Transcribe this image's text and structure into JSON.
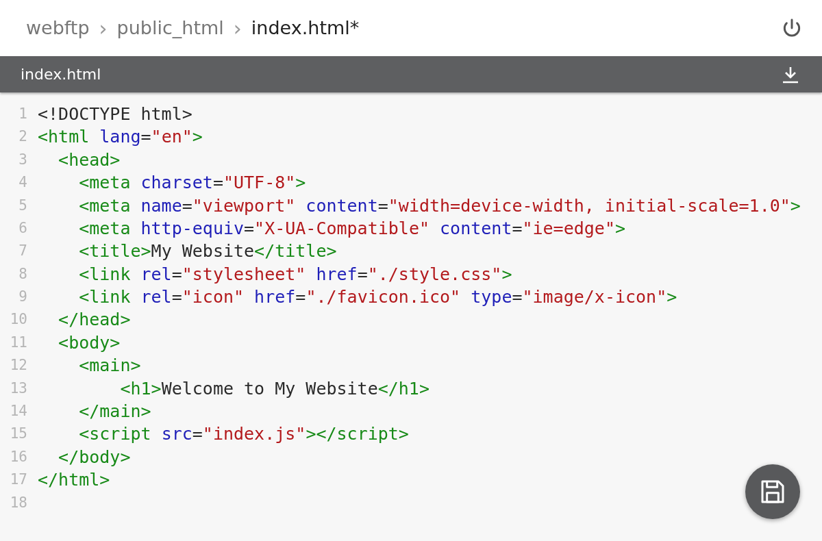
{
  "breadcrumb": [
    {
      "label": "webftp",
      "current": false
    },
    {
      "label": "›",
      "kind": "separator"
    },
    {
      "label": "public_html",
      "current": false
    },
    {
      "label": "›",
      "kind": "separator"
    },
    {
      "label": "index.html*",
      "current": true
    }
  ],
  "file_bar": {
    "title": "index.html"
  },
  "editor": {
    "lines": [
      {
        "number": "1",
        "tokens": [
          {
            "kind": "plain",
            "text": "<!DOCTYPE html>"
          }
        ]
      },
      {
        "number": "2",
        "tokens": [
          {
            "kind": "tag",
            "text": "<html"
          },
          {
            "kind": "attr",
            "text": " lang"
          },
          {
            "kind": "plain",
            "text": "="
          },
          {
            "kind": "str",
            "text": "\"en\""
          },
          {
            "kind": "tag",
            "text": ">"
          }
        ]
      },
      {
        "number": "3",
        "tokens": [
          {
            "kind": "tag",
            "text": "  <head>"
          }
        ]
      },
      {
        "number": "4",
        "tokens": [
          {
            "kind": "tag",
            "text": "    <meta"
          },
          {
            "kind": "attr",
            "text": " charset"
          },
          {
            "kind": "plain",
            "text": "="
          },
          {
            "kind": "str",
            "text": "\"UTF-8\""
          },
          {
            "kind": "tag",
            "text": ">"
          }
        ]
      },
      {
        "number": "5",
        "tokens": [
          {
            "kind": "tag",
            "text": "    <meta"
          },
          {
            "kind": "attr",
            "text": " name"
          },
          {
            "kind": "plain",
            "text": "="
          },
          {
            "kind": "str",
            "text": "\"viewport\""
          },
          {
            "kind": "attr",
            "text": " content"
          },
          {
            "kind": "plain",
            "text": "="
          },
          {
            "kind": "str",
            "text": "\"width=device-width, initial-scale=1.0\""
          },
          {
            "kind": "tag",
            "text": ">"
          }
        ]
      },
      {
        "number": "6",
        "tokens": [
          {
            "kind": "tag",
            "text": "    <meta"
          },
          {
            "kind": "attr",
            "text": " http-equiv"
          },
          {
            "kind": "plain",
            "text": "="
          },
          {
            "kind": "str",
            "text": "\"X-UA-Compatible\""
          },
          {
            "kind": "attr",
            "text": " content"
          },
          {
            "kind": "plain",
            "text": "="
          },
          {
            "kind": "str",
            "text": "\"ie=edge\""
          },
          {
            "kind": "tag",
            "text": ">"
          }
        ]
      },
      {
        "number": "7",
        "tokens": [
          {
            "kind": "tag",
            "text": "    <title>"
          },
          {
            "kind": "plain",
            "text": "My Website"
          },
          {
            "kind": "tag",
            "text": "</title>"
          }
        ]
      },
      {
        "number": "8",
        "tokens": [
          {
            "kind": "tag",
            "text": "    <link"
          },
          {
            "kind": "attr",
            "text": " rel"
          },
          {
            "kind": "plain",
            "text": "="
          },
          {
            "kind": "str",
            "text": "\"stylesheet\""
          },
          {
            "kind": "attr",
            "text": " href"
          },
          {
            "kind": "plain",
            "text": "="
          },
          {
            "kind": "str",
            "text": "\"./style.css\""
          },
          {
            "kind": "tag",
            "text": ">"
          }
        ]
      },
      {
        "number": "9",
        "tokens": [
          {
            "kind": "tag",
            "text": "    <link"
          },
          {
            "kind": "attr",
            "text": " rel"
          },
          {
            "kind": "plain",
            "text": "="
          },
          {
            "kind": "str",
            "text": "\"icon\""
          },
          {
            "kind": "attr",
            "text": " href"
          },
          {
            "kind": "plain",
            "text": "="
          },
          {
            "kind": "str",
            "text": "\"./favicon.ico\""
          },
          {
            "kind": "attr",
            "text": " type"
          },
          {
            "kind": "plain",
            "text": "="
          },
          {
            "kind": "str",
            "text": "\"image/x-icon\""
          },
          {
            "kind": "tag",
            "text": ">"
          }
        ]
      },
      {
        "number": "10",
        "tokens": [
          {
            "kind": "tag",
            "text": "  </head>"
          }
        ]
      },
      {
        "number": "11",
        "tokens": [
          {
            "kind": "tag",
            "text": "  <body>"
          }
        ]
      },
      {
        "number": "12",
        "tokens": [
          {
            "kind": "tag",
            "text": "    <main>"
          }
        ]
      },
      {
        "number": "13",
        "tokens": [
          {
            "kind": "tag",
            "text": "        <h1>"
          },
          {
            "kind": "plain",
            "text": "Welcome to My Website"
          },
          {
            "kind": "tag",
            "text": "</h1>"
          }
        ]
      },
      {
        "number": "14",
        "tokens": [
          {
            "kind": "tag",
            "text": "    </main>"
          }
        ]
      },
      {
        "number": "15",
        "tokens": [
          {
            "kind": "tag",
            "text": "    <script"
          },
          {
            "kind": "attr",
            "text": " src"
          },
          {
            "kind": "plain",
            "text": "="
          },
          {
            "kind": "str",
            "text": "\"index.js\""
          },
          {
            "kind": "tag",
            "text": "></script>"
          }
        ]
      },
      {
        "number": "16",
        "tokens": [
          {
            "kind": "tag",
            "text": "  </body>"
          }
        ]
      },
      {
        "number": "17",
        "tokens": [
          {
            "kind": "tag",
            "text": "</html>"
          }
        ]
      },
      {
        "number": "18"
      }
    ]
  }
}
